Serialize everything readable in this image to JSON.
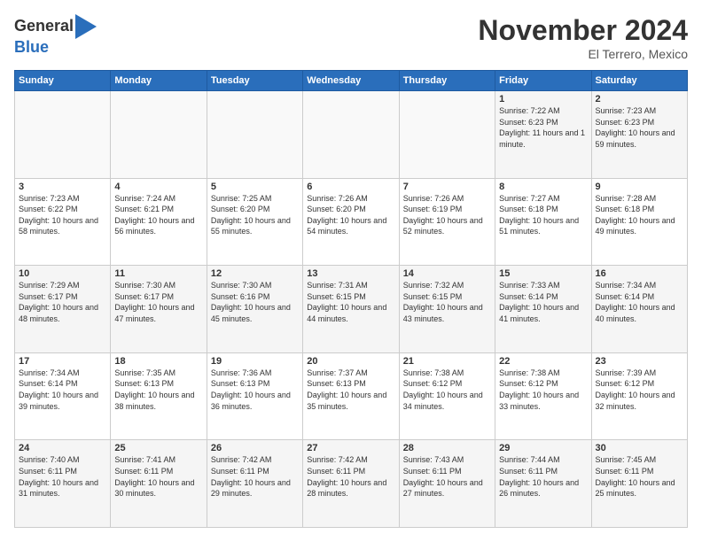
{
  "logo": {
    "general": "General",
    "blue": "Blue"
  },
  "title": "November 2024",
  "location": "El Terrero, Mexico",
  "days_header": [
    "Sunday",
    "Monday",
    "Tuesday",
    "Wednesday",
    "Thursday",
    "Friday",
    "Saturday"
  ],
  "weeks": [
    [
      {
        "num": "",
        "info": ""
      },
      {
        "num": "",
        "info": ""
      },
      {
        "num": "",
        "info": ""
      },
      {
        "num": "",
        "info": ""
      },
      {
        "num": "",
        "info": ""
      },
      {
        "num": "1",
        "info": "Sunrise: 7:22 AM\nSunset: 6:23 PM\nDaylight: 11 hours and 1 minute."
      },
      {
        "num": "2",
        "info": "Sunrise: 7:23 AM\nSunset: 6:23 PM\nDaylight: 10 hours and 59 minutes."
      }
    ],
    [
      {
        "num": "3",
        "info": "Sunrise: 7:23 AM\nSunset: 6:22 PM\nDaylight: 10 hours and 58 minutes."
      },
      {
        "num": "4",
        "info": "Sunrise: 7:24 AM\nSunset: 6:21 PM\nDaylight: 10 hours and 56 minutes."
      },
      {
        "num": "5",
        "info": "Sunrise: 7:25 AM\nSunset: 6:20 PM\nDaylight: 10 hours and 55 minutes."
      },
      {
        "num": "6",
        "info": "Sunrise: 7:26 AM\nSunset: 6:20 PM\nDaylight: 10 hours and 54 minutes."
      },
      {
        "num": "7",
        "info": "Sunrise: 7:26 AM\nSunset: 6:19 PM\nDaylight: 10 hours and 52 minutes."
      },
      {
        "num": "8",
        "info": "Sunrise: 7:27 AM\nSunset: 6:18 PM\nDaylight: 10 hours and 51 minutes."
      },
      {
        "num": "9",
        "info": "Sunrise: 7:28 AM\nSunset: 6:18 PM\nDaylight: 10 hours and 49 minutes."
      }
    ],
    [
      {
        "num": "10",
        "info": "Sunrise: 7:29 AM\nSunset: 6:17 PM\nDaylight: 10 hours and 48 minutes."
      },
      {
        "num": "11",
        "info": "Sunrise: 7:30 AM\nSunset: 6:17 PM\nDaylight: 10 hours and 47 minutes."
      },
      {
        "num": "12",
        "info": "Sunrise: 7:30 AM\nSunset: 6:16 PM\nDaylight: 10 hours and 45 minutes."
      },
      {
        "num": "13",
        "info": "Sunrise: 7:31 AM\nSunset: 6:15 PM\nDaylight: 10 hours and 44 minutes."
      },
      {
        "num": "14",
        "info": "Sunrise: 7:32 AM\nSunset: 6:15 PM\nDaylight: 10 hours and 43 minutes."
      },
      {
        "num": "15",
        "info": "Sunrise: 7:33 AM\nSunset: 6:14 PM\nDaylight: 10 hours and 41 minutes."
      },
      {
        "num": "16",
        "info": "Sunrise: 7:34 AM\nSunset: 6:14 PM\nDaylight: 10 hours and 40 minutes."
      }
    ],
    [
      {
        "num": "17",
        "info": "Sunrise: 7:34 AM\nSunset: 6:14 PM\nDaylight: 10 hours and 39 minutes."
      },
      {
        "num": "18",
        "info": "Sunrise: 7:35 AM\nSunset: 6:13 PM\nDaylight: 10 hours and 38 minutes."
      },
      {
        "num": "19",
        "info": "Sunrise: 7:36 AM\nSunset: 6:13 PM\nDaylight: 10 hours and 36 minutes."
      },
      {
        "num": "20",
        "info": "Sunrise: 7:37 AM\nSunset: 6:13 PM\nDaylight: 10 hours and 35 minutes."
      },
      {
        "num": "21",
        "info": "Sunrise: 7:38 AM\nSunset: 6:12 PM\nDaylight: 10 hours and 34 minutes."
      },
      {
        "num": "22",
        "info": "Sunrise: 7:38 AM\nSunset: 6:12 PM\nDaylight: 10 hours and 33 minutes."
      },
      {
        "num": "23",
        "info": "Sunrise: 7:39 AM\nSunset: 6:12 PM\nDaylight: 10 hours and 32 minutes."
      }
    ],
    [
      {
        "num": "24",
        "info": "Sunrise: 7:40 AM\nSunset: 6:11 PM\nDaylight: 10 hours and 31 minutes."
      },
      {
        "num": "25",
        "info": "Sunrise: 7:41 AM\nSunset: 6:11 PM\nDaylight: 10 hours and 30 minutes."
      },
      {
        "num": "26",
        "info": "Sunrise: 7:42 AM\nSunset: 6:11 PM\nDaylight: 10 hours and 29 minutes."
      },
      {
        "num": "27",
        "info": "Sunrise: 7:42 AM\nSunset: 6:11 PM\nDaylight: 10 hours and 28 minutes."
      },
      {
        "num": "28",
        "info": "Sunrise: 7:43 AM\nSunset: 6:11 PM\nDaylight: 10 hours and 27 minutes."
      },
      {
        "num": "29",
        "info": "Sunrise: 7:44 AM\nSunset: 6:11 PM\nDaylight: 10 hours and 26 minutes."
      },
      {
        "num": "30",
        "info": "Sunrise: 7:45 AM\nSunset: 6:11 PM\nDaylight: 10 hours and 25 minutes."
      }
    ]
  ]
}
